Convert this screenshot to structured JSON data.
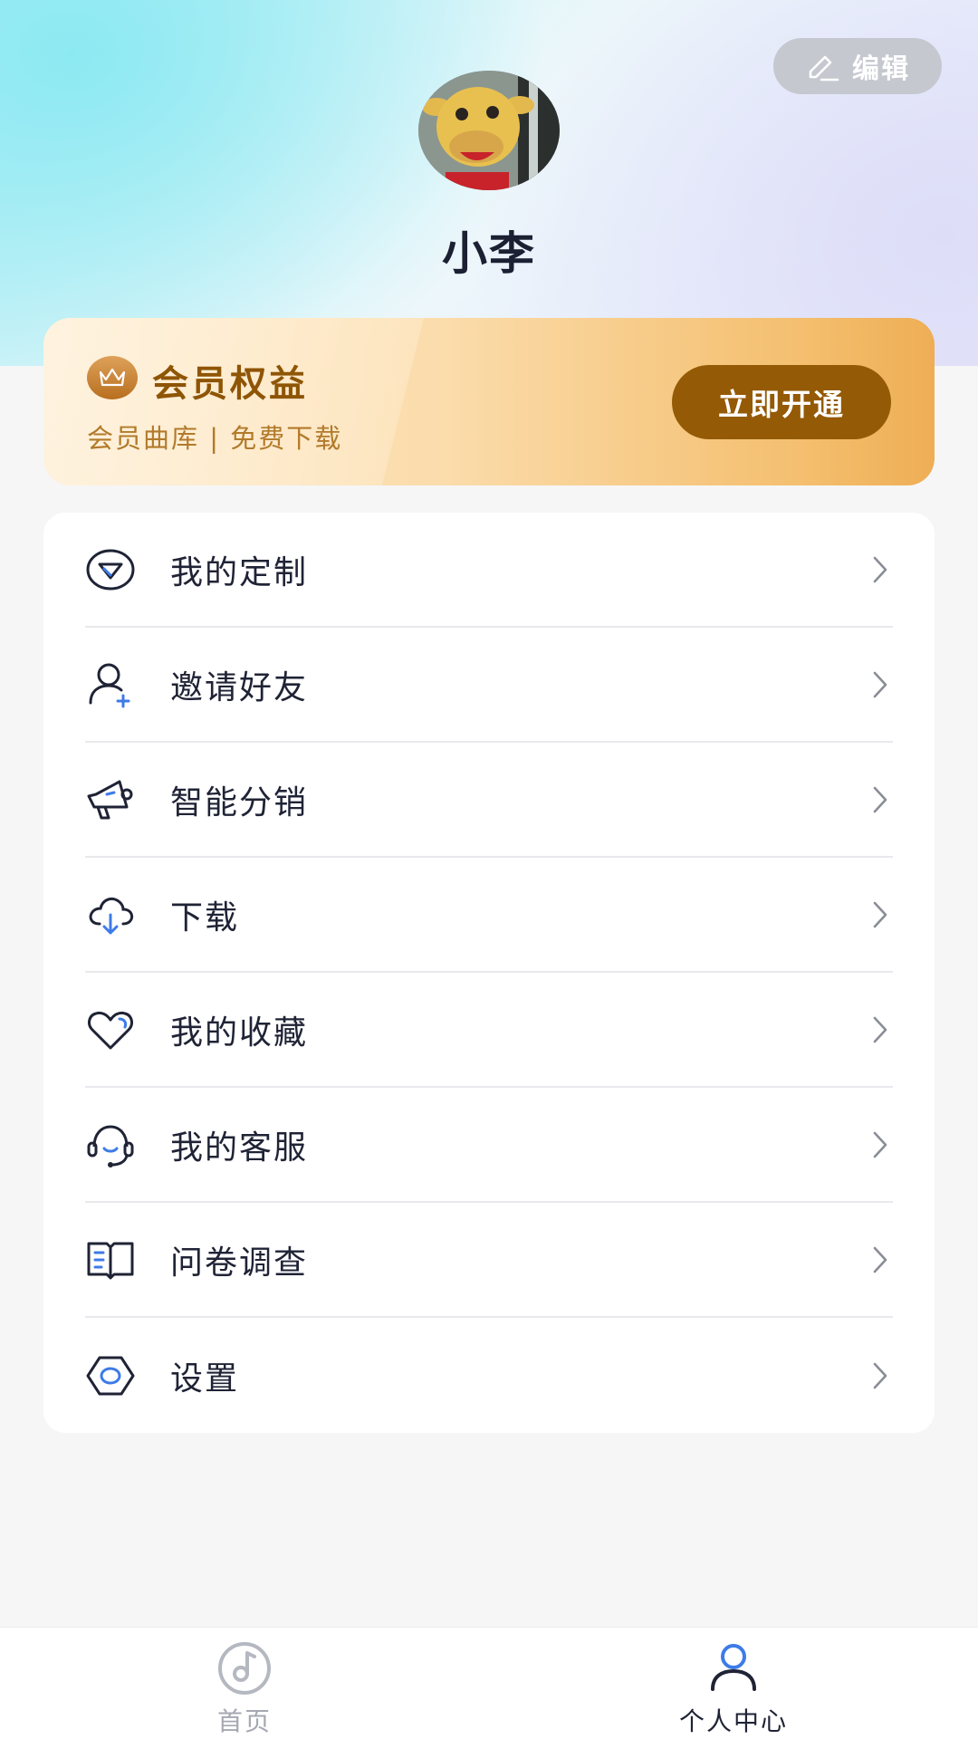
{
  "header": {
    "edit_label": "编辑",
    "username": "小李"
  },
  "vip": {
    "title": "会员权益",
    "subtitle": "会员曲库 | 免费下载",
    "button_label": "立即开通"
  },
  "menu": {
    "items": [
      {
        "label": "我的定制",
        "icon": "diamond-icon"
      },
      {
        "label": "邀请好友",
        "icon": "add-user-icon"
      },
      {
        "label": "智能分销",
        "icon": "megaphone-icon"
      },
      {
        "label": "下载",
        "icon": "cloud-download-icon"
      },
      {
        "label": "我的收藏",
        "icon": "heart-icon"
      },
      {
        "label": "我的客服",
        "icon": "headset-icon"
      },
      {
        "label": "问卷调查",
        "icon": "book-icon"
      },
      {
        "label": "设置",
        "icon": "hexagon-settings-icon"
      }
    ]
  },
  "tabbar": {
    "home_label": "首页",
    "me_label": "个人中心",
    "active": "个人中心"
  },
  "colors": {
    "accent_blue": "#3d7be8",
    "vip_brown": "#945a06",
    "icon_dark": "#1f2335"
  }
}
